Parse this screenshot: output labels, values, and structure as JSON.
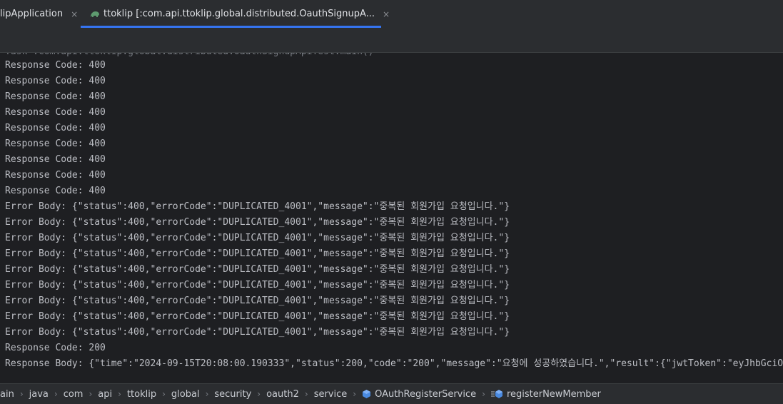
{
  "tabs": [
    {
      "label": "lipApplication",
      "close": "×"
    },
    {
      "label": "ttoklip [:com.api.ttoklip.global.distributed.OauthSignupA...",
      "close": "×"
    }
  ],
  "console": {
    "clipped_line": "Task :com.api.ttoklip.global.distributed.OauthSignupApiTest.main()",
    "lines": [
      "Response Code: 400",
      "Response Code: 400",
      "Response Code: 400",
      "Response Code: 400",
      "Response Code: 400",
      "Response Code: 400",
      "Response Code: 400",
      "Response Code: 400",
      "Response Code: 400",
      "Error Body: {\"status\":400,\"errorCode\":\"DUPLICATED_4001\",\"message\":\"중복된 회원가입 요청입니다.\"}",
      "Error Body: {\"status\":400,\"errorCode\":\"DUPLICATED_4001\",\"message\":\"중복된 회원가입 요청입니다.\"}",
      "Error Body: {\"status\":400,\"errorCode\":\"DUPLICATED_4001\",\"message\":\"중복된 회원가입 요청입니다.\"}",
      "Error Body: {\"status\":400,\"errorCode\":\"DUPLICATED_4001\",\"message\":\"중복된 회원가입 요청입니다.\"}",
      "Error Body: {\"status\":400,\"errorCode\":\"DUPLICATED_4001\",\"message\":\"중복된 회원가입 요청입니다.\"}",
      "Error Body: {\"status\":400,\"errorCode\":\"DUPLICATED_4001\",\"message\":\"중복된 회원가입 요청입니다.\"}",
      "Error Body: {\"status\":400,\"errorCode\":\"DUPLICATED_4001\",\"message\":\"중복된 회원가입 요청입니다.\"}",
      "Error Body: {\"status\":400,\"errorCode\":\"DUPLICATED_4001\",\"message\":\"중복된 회원가입 요청입니다.\"}",
      "Error Body: {\"status\":400,\"errorCode\":\"DUPLICATED_4001\",\"message\":\"중복된 회원가입 요청입니다.\"}",
      "Response Code: 200",
      "Response Body: {\"time\":\"2024-09-15T20:08:00.190333\",\"status\":200,\"code\":\"200\",\"message\":\"요청에 성공하였습니다.\",\"result\":{\"jwtToken\":\"eyJhbGciOi"
    ]
  },
  "breadcrumbs": {
    "items": [
      "ain",
      "java",
      "com",
      "api",
      "ttoklip",
      "global",
      "security",
      "oauth2",
      "service",
      "OAuthRegisterService",
      "registerNewMember"
    ],
    "separator": "›",
    "class_icon": "class-icon",
    "method_icon": "method-icon"
  },
  "colors": {
    "accent": "#3574f0",
    "console_text": "#bcbec4",
    "background": "#1e1f22",
    "panel": "#2b2d30"
  }
}
